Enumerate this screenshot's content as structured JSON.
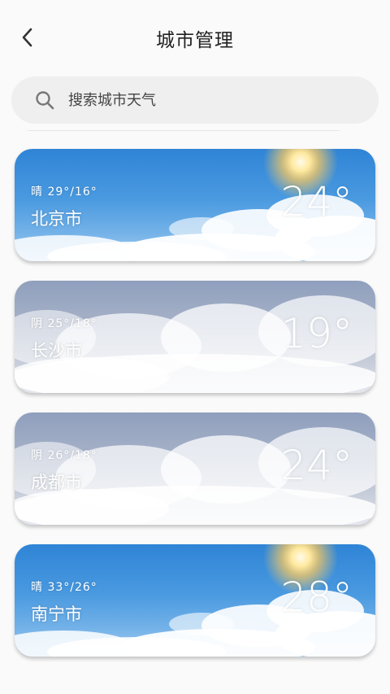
{
  "header": {
    "title": "城市管理",
    "back_icon": "chevron-left-icon"
  },
  "search": {
    "placeholder": "搜索城市天气",
    "icon": "search-icon"
  },
  "cities": [
    {
      "name": "北京市",
      "condition": "晴",
      "high": "29°",
      "low": "16°",
      "range": "晴 29°/16°",
      "temp": "24°",
      "theme": "sunny"
    },
    {
      "name": "长沙市",
      "condition": "阴",
      "high": "25°",
      "low": "18°",
      "range": "阴 25°/18°",
      "temp": "19°",
      "theme": "cloudy"
    },
    {
      "name": "成都市",
      "condition": "阴",
      "high": "26°",
      "low": "18°",
      "range": "阴 26°/18°",
      "temp": "24°",
      "theme": "cloudy"
    },
    {
      "name": "南宁市",
      "condition": "晴",
      "high": "33°",
      "low": "26°",
      "range": "晴 33°/26°",
      "temp": "28°",
      "theme": "sunny"
    }
  ],
  "colors": {
    "sunny_top": "#2f84d6",
    "cloudy_top": "#8f9fbd",
    "background": "#fafafa",
    "search_bg": "#efefef"
  }
}
